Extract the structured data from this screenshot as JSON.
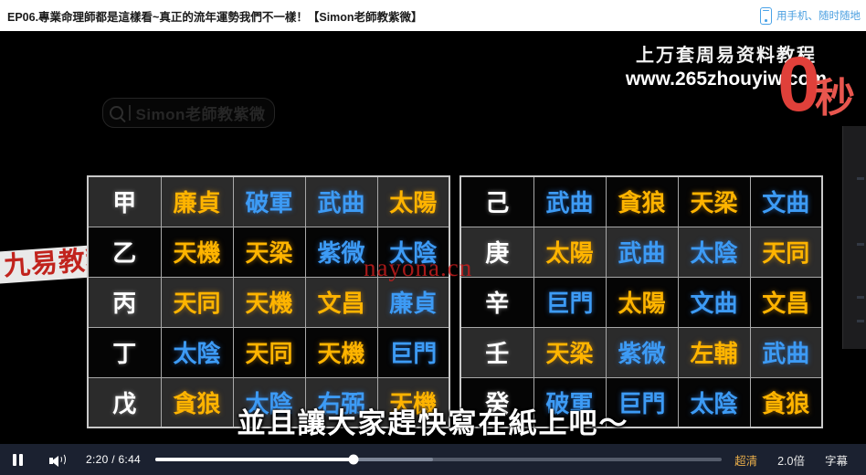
{
  "header": {
    "title": "EP06.專業命理師都是這樣看~真正的流年運勢我們不一樣！【Simon老師教紫微】",
    "mobile_icon": "phone-icon",
    "mobile_text": "用手机、随时随地"
  },
  "video": {
    "watermark_search": {
      "icon": "search-icon",
      "text": "Simon老師教紫微"
    },
    "promo": {
      "line1": "上万套周易资料教程",
      "line2": "www.265zhouyiw.com",
      "zero": "0",
      "unit": "秒"
    },
    "watermark_banner": "九易教程",
    "watermark_center": "nayona.cn",
    "subtitle": "並且讓大家趕快寫在紙上吧～",
    "colors": {
      "gold": "#ffb400",
      "blue": "#3d9bf5",
      "stem": "#ffffff",
      "row_dark": "#2b2b2b",
      "row_black": "#050505"
    },
    "table_left": [
      {
        "stem": "甲",
        "shade": "dark",
        "stars": [
          {
            "t": "廉貞",
            "c": "gold"
          },
          {
            "t": "破軍",
            "c": "blue"
          },
          {
            "t": "武曲",
            "c": "blue"
          },
          {
            "t": "太陽",
            "c": "gold"
          }
        ]
      },
      {
        "stem": "乙",
        "shade": "black",
        "stars": [
          {
            "t": "天機",
            "c": "gold"
          },
          {
            "t": "天梁",
            "c": "gold"
          },
          {
            "t": "紫微",
            "c": "blue"
          },
          {
            "t": "太陰",
            "c": "blue"
          }
        ]
      },
      {
        "stem": "丙",
        "shade": "dark",
        "stars": [
          {
            "t": "天同",
            "c": "gold"
          },
          {
            "t": "天機",
            "c": "gold"
          },
          {
            "t": "文昌",
            "c": "gold"
          },
          {
            "t": "廉貞",
            "c": "blue"
          }
        ]
      },
      {
        "stem": "丁",
        "shade": "black",
        "stars": [
          {
            "t": "太陰",
            "c": "blue"
          },
          {
            "t": "天同",
            "c": "gold"
          },
          {
            "t": "天機",
            "c": "gold"
          },
          {
            "t": "巨門",
            "c": "blue"
          }
        ]
      },
      {
        "stem": "戊",
        "shade": "dark",
        "stars": [
          {
            "t": "貪狼",
            "c": "gold"
          },
          {
            "t": "太陰",
            "c": "blue"
          },
          {
            "t": "右弼",
            "c": "blue"
          },
          {
            "t": "天機",
            "c": "gold"
          }
        ]
      }
    ],
    "table_right": [
      {
        "stem": "己",
        "shade": "black",
        "stars": [
          {
            "t": "武曲",
            "c": "blue"
          },
          {
            "t": "貪狼",
            "c": "gold"
          },
          {
            "t": "天梁",
            "c": "gold"
          },
          {
            "t": "文曲",
            "c": "blue"
          }
        ]
      },
      {
        "stem": "庚",
        "shade": "dark",
        "stars": [
          {
            "t": "太陽",
            "c": "gold"
          },
          {
            "t": "武曲",
            "c": "blue"
          },
          {
            "t": "太陰",
            "c": "blue"
          },
          {
            "t": "天同",
            "c": "gold"
          }
        ]
      },
      {
        "stem": "辛",
        "shade": "black",
        "stars": [
          {
            "t": "巨門",
            "c": "blue"
          },
          {
            "t": "太陽",
            "c": "gold"
          },
          {
            "t": "文曲",
            "c": "blue"
          },
          {
            "t": "文昌",
            "c": "gold"
          }
        ]
      },
      {
        "stem": "壬",
        "shade": "dark",
        "stars": [
          {
            "t": "天梁",
            "c": "gold"
          },
          {
            "t": "紫微",
            "c": "blue"
          },
          {
            "t": "左輔",
            "c": "gold"
          },
          {
            "t": "武曲",
            "c": "blue"
          }
        ]
      },
      {
        "stem": "癸",
        "shade": "black",
        "stars": [
          {
            "t": "破軍",
            "c": "blue"
          },
          {
            "t": "巨門",
            "c": "blue"
          },
          {
            "t": "太陰",
            "c": "blue"
          },
          {
            "t": "貪狼",
            "c": "gold"
          }
        ]
      }
    ]
  },
  "controls": {
    "play_state_icon": "pause-icon",
    "volume_icon": "volume-icon",
    "current_time": "2:20",
    "duration": "6:44",
    "time_display": "2:20 / 6:44",
    "progress_percent": 35,
    "buffer_percent": 49,
    "quality_label": "超清",
    "speed_label": "2.0倍",
    "subtitle_label": "字幕"
  }
}
